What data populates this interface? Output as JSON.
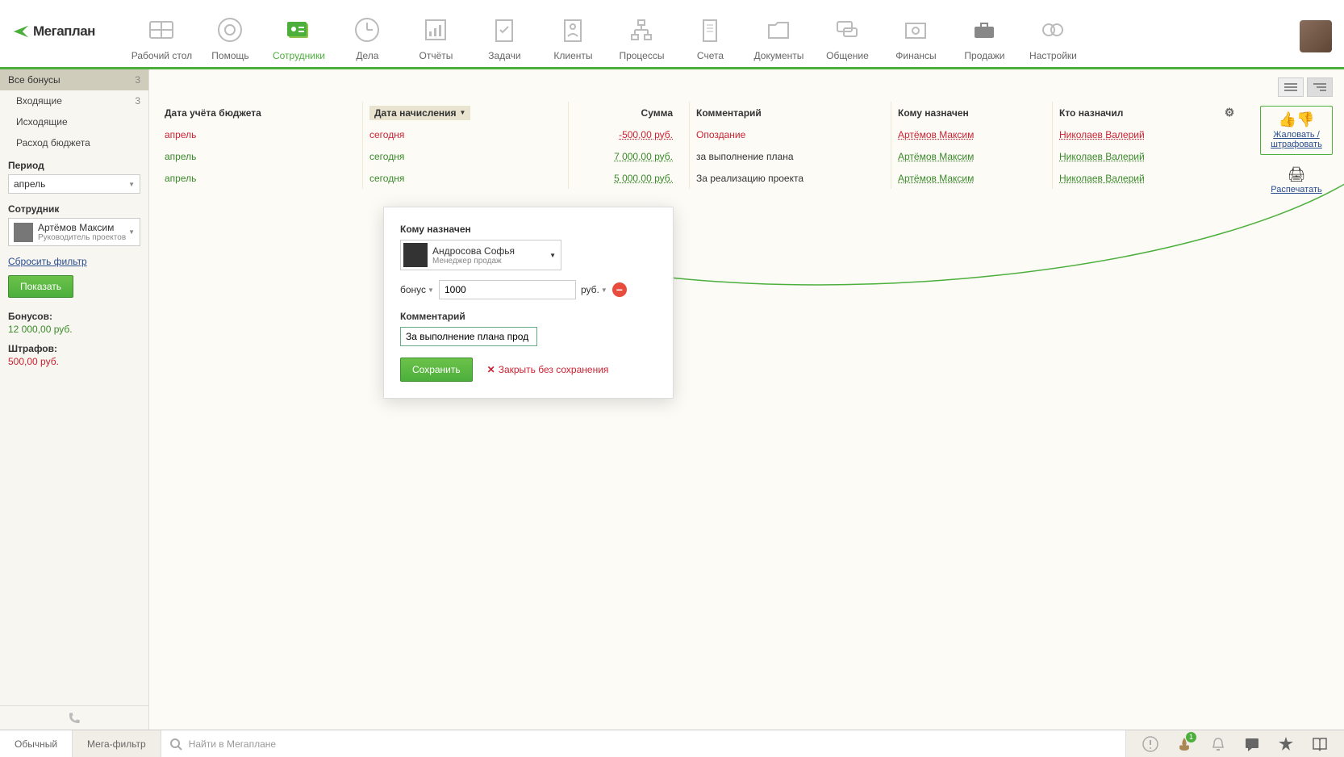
{
  "logo_text": "Мегаплан",
  "nav": [
    {
      "label": "Рабочий стол"
    },
    {
      "label": "Помощь"
    },
    {
      "label": "Сотрудники"
    },
    {
      "label": "Дела"
    },
    {
      "label": "Отчёты"
    },
    {
      "label": "Задачи"
    },
    {
      "label": "Клиенты"
    },
    {
      "label": "Процессы"
    },
    {
      "label": "Счета"
    },
    {
      "label": "Документы"
    },
    {
      "label": "Общение"
    },
    {
      "label": "Финансы"
    },
    {
      "label": "Продажи"
    },
    {
      "label": "Настройки"
    }
  ],
  "sidebar": {
    "all_bonuses": "Все бонусы",
    "all_count": "3",
    "incoming": "Входящие",
    "incoming_count": "3",
    "outgoing": "Исходящие",
    "budget": "Расход бюджета",
    "period_h": "Период",
    "period_val": "апрель",
    "employee_h": "Сотрудник",
    "employee_name": "Артёмов Максим",
    "employee_role": "Руководитель проектов",
    "reset_link": "Сбросить фильтр",
    "show_btn": "Показать",
    "bonus_h": "Бонусов:",
    "bonus_val": "12 000,00 руб.",
    "fine_h": "Штрафов:",
    "fine_val": "500,00 руб."
  },
  "table": {
    "h_budget": "Дата учёта бюджета",
    "h_date": "Дата начисления",
    "h_sum": "Сумма",
    "h_comment": "Комментарий",
    "h_assignee": "Кому назначен",
    "h_assigner": "Кто назначил",
    "rows": [
      {
        "budget": "апрель",
        "date": "сегодня",
        "sum": "-500,00 руб.",
        "comment": "Опоздание",
        "assignee": "Артёмов Максим",
        "assigner": "Николаев Валерий",
        "tone": "red"
      },
      {
        "budget": "апрель",
        "date": "сегодня",
        "sum": "7 000,00 руб.",
        "comment": "за выполнение плана",
        "assignee": "Артёмов Максим",
        "assigner": "Николаев Валерий",
        "tone": "green"
      },
      {
        "budget": "апрель",
        "date": "сегодня",
        "sum": "5 000,00 руб.",
        "comment": "За реализацию проекта",
        "assignee": "Артёмов Максим",
        "assigner": "Николаев Валерий",
        "tone": "green"
      }
    ]
  },
  "actions": {
    "reward": "Жаловать / штрафовать",
    "print": "Распечатать"
  },
  "modal": {
    "assignee_label": "Кому назначен",
    "assignee_name": "Андросова Софья",
    "assignee_role": "Менеджер продаж",
    "bonus_type": "бонус",
    "bonus_value": "1000",
    "currency": "руб.",
    "comment_label": "Комментарий",
    "comment_value": "За выполнение плана прод",
    "save": "Сохранить",
    "cancel": "Закрыть без сохранения"
  },
  "footer": {
    "tab_normal": "Обычный",
    "tab_mega": "Мега-фильтр",
    "search_placeholder": "Найти в Мегаплане",
    "fire_badge": "1"
  }
}
